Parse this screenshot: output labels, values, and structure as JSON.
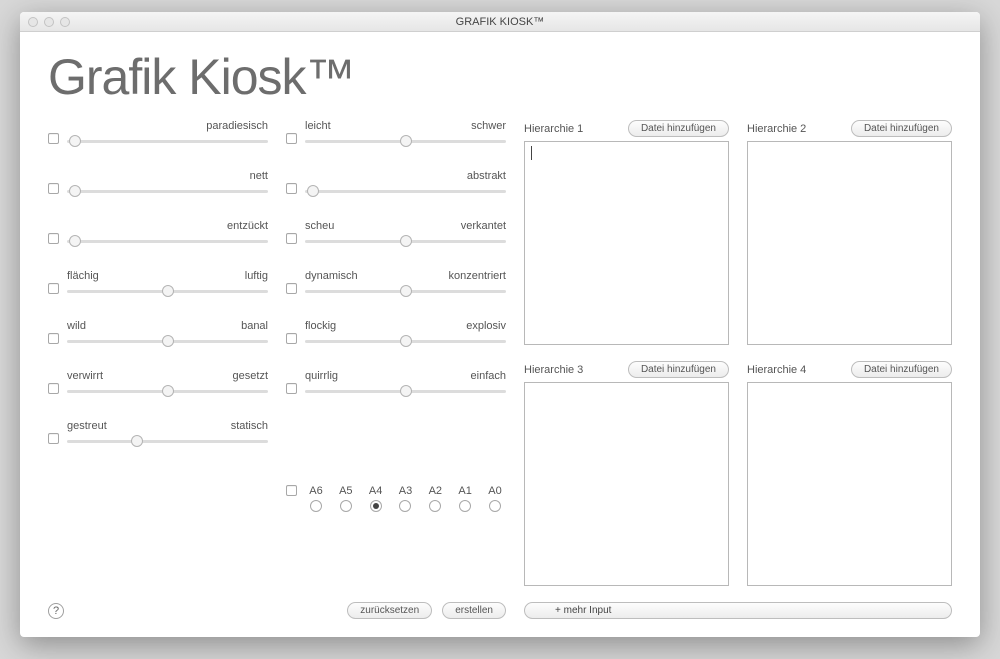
{
  "window": {
    "title": "GRAFIK KIOSK™"
  },
  "app_title": "Grafik Kiosk™",
  "sliders_left": [
    {
      "left": "",
      "right": "paradiesisch",
      "pos": 4
    },
    {
      "left": "",
      "right": "nett",
      "pos": 4
    },
    {
      "left": "",
      "right": "entzückt",
      "pos": 4
    },
    {
      "left": "flächig",
      "right": "luftig",
      "pos": 50
    },
    {
      "left": "wild",
      "right": "banal",
      "pos": 50
    },
    {
      "left": "verwirrt",
      "right": "gesetzt",
      "pos": 50
    },
    {
      "left": "gestreut",
      "right": "statisch",
      "pos": 35
    }
  ],
  "sliders_right": [
    {
      "left": "leicht",
      "right": "schwer",
      "pos": 50
    },
    {
      "left": "",
      "right": "abstrakt",
      "pos": 4
    },
    {
      "left": "scheu",
      "right": "verkantet",
      "pos": 50
    },
    {
      "left": "dynamisch",
      "right": "konzentriert",
      "pos": 50
    },
    {
      "left": "flockig",
      "right": "explosiv",
      "pos": 50
    },
    {
      "left": "quirrlig",
      "right": "einfach",
      "pos": 50
    }
  ],
  "formats": {
    "options": [
      "A6",
      "A5",
      "A4",
      "A3",
      "A2",
      "A1",
      "A0"
    ],
    "selected": "A4"
  },
  "buttons": {
    "reset": "zurücksetzen",
    "create": "erstellen",
    "more_input": "+ mehr Input",
    "add_file": "Datei hinzufügen",
    "help": "?"
  },
  "hierarchies": [
    {
      "label": "Hierarchie 1",
      "value": "",
      "focused": true
    },
    {
      "label": "Hierarchie 2",
      "value": "",
      "focused": false
    },
    {
      "label": "Hierarchie 3",
      "value": "",
      "focused": false
    },
    {
      "label": "Hierarchie 4",
      "value": "",
      "focused": false
    }
  ]
}
